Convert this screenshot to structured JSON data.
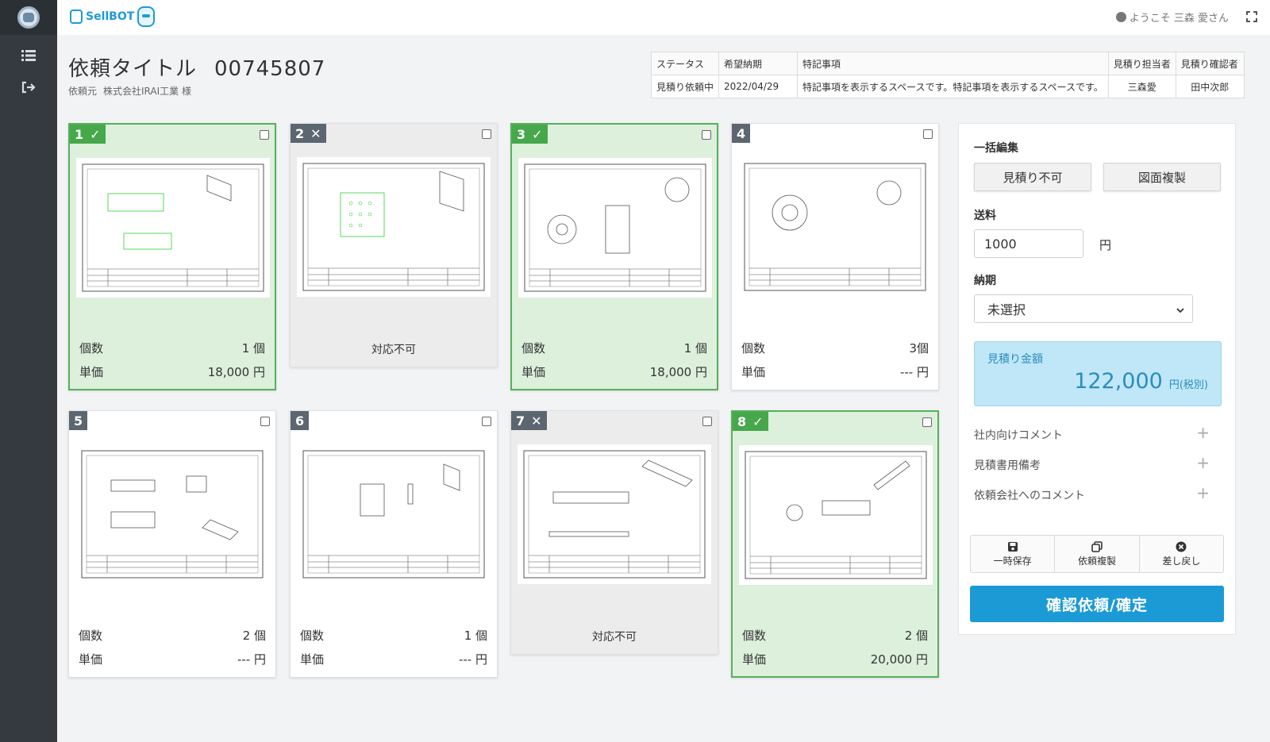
{
  "app": {
    "brand": "SellBOT"
  },
  "user": {
    "greeting": "ようこそ 三森 愛さん"
  },
  "request": {
    "title_label": "依頼タイトル",
    "title_number": "00745807",
    "client_label": "依頼元",
    "client_name": "株式会社IRAI工業 様"
  },
  "info_table": {
    "headers": [
      "ステータス",
      "希望納期",
      "特記事項",
      "見積り担当者",
      "見積り確認者"
    ],
    "values": [
      "見積り依頼中",
      "2022/04/29",
      "特記事項を表示するスペースです。特記事項を表示するスペースです。",
      "三森愛",
      "田中次郎"
    ]
  },
  "labels": {
    "qty": "個数",
    "unit_price": "単価",
    "unavailable": "対応不可"
  },
  "cards": [
    {
      "number": "1",
      "status": "ok",
      "mark": "✓",
      "qty": "1 個",
      "price": "18,000 円"
    },
    {
      "number": "2",
      "status": "ng",
      "mark": "✕"
    },
    {
      "number": "3",
      "status": "ok",
      "mark": "✓",
      "qty": "1 個",
      "price": "18,000 円"
    },
    {
      "number": "4",
      "status": "none",
      "mark": "",
      "qty": "3個",
      "price": "--- 円"
    },
    {
      "number": "5",
      "status": "none",
      "mark": "",
      "qty": "2 個",
      "price": "--- 円"
    },
    {
      "number": "6",
      "status": "none",
      "mark": "",
      "qty": "1 個",
      "price": "--- 円"
    },
    {
      "number": "7",
      "status": "ng",
      "mark": "✕"
    },
    {
      "number": "8",
      "status": "ok",
      "mark": "✓",
      "qty": "2 個",
      "price": "20,000 円"
    }
  ],
  "panel": {
    "bulk_edit": "一括編集",
    "btn_unavailable": "見積り不可",
    "btn_copy_drawing": "図面複製",
    "shipping_label": "送料",
    "shipping_value": "1000",
    "shipping_unit": "円",
    "delivery_label": "納期",
    "delivery_selected": "未選択",
    "quote_label": "見積り金額",
    "quote_amount": "122,000",
    "quote_unit": "円(税別)",
    "comments": [
      "社内向けコメント",
      "見積書用備考",
      "依頼会社へのコメント"
    ],
    "plus": "+",
    "actions": [
      "一時保存",
      "依頼複製",
      "差し戻し"
    ],
    "confirm": "確認依頼/確定"
  },
  "colors": {
    "sidebar": "#343a40",
    "accent": "#1c9ad6",
    "ok_bg": "#dcf0dc",
    "ok_border": "#58b05c",
    "ng_bg": "#ececec",
    "quote_bg": "#bfe7f7"
  }
}
